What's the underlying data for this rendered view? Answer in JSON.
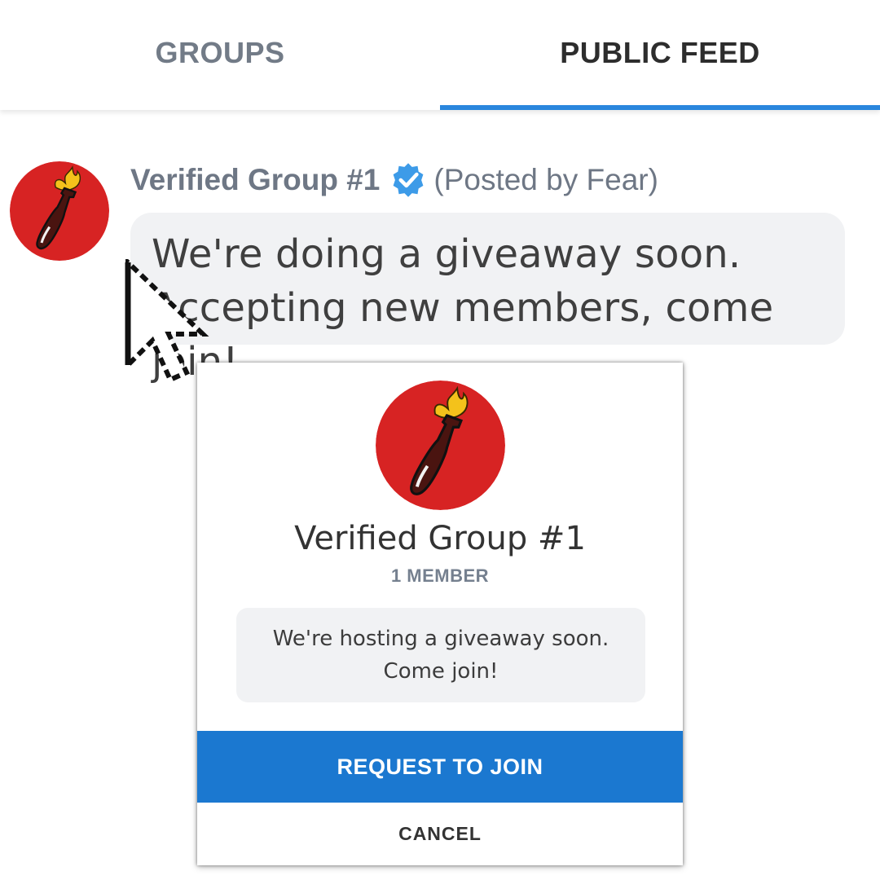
{
  "tabs": {
    "groups_label": "GROUPS",
    "public_feed_label": "PUBLIC FEED",
    "active": "public_feed"
  },
  "post": {
    "group_name": "Verified Group #1",
    "badge_icon": "verified-check-icon",
    "posted_by": "(Posted by Fear)",
    "message": "We're doing a giveaway soon. Accepting new members, come join!",
    "avatar_icon": "flaming-bottle-icon"
  },
  "modal": {
    "avatar_icon": "flaming-bottle-icon",
    "group_name": "Verified Group #1",
    "member_count": "1 MEMBER",
    "description": "We're hosting a giveaway soon. Come join!",
    "request_button": "REQUEST TO JOIN",
    "cancel_button": "CANCEL"
  },
  "colors": {
    "accent": "#1b78d0",
    "tab_indicator": "#2a86dd",
    "avatar_red": "#d72323",
    "badge_blue": "#3d9be8"
  }
}
